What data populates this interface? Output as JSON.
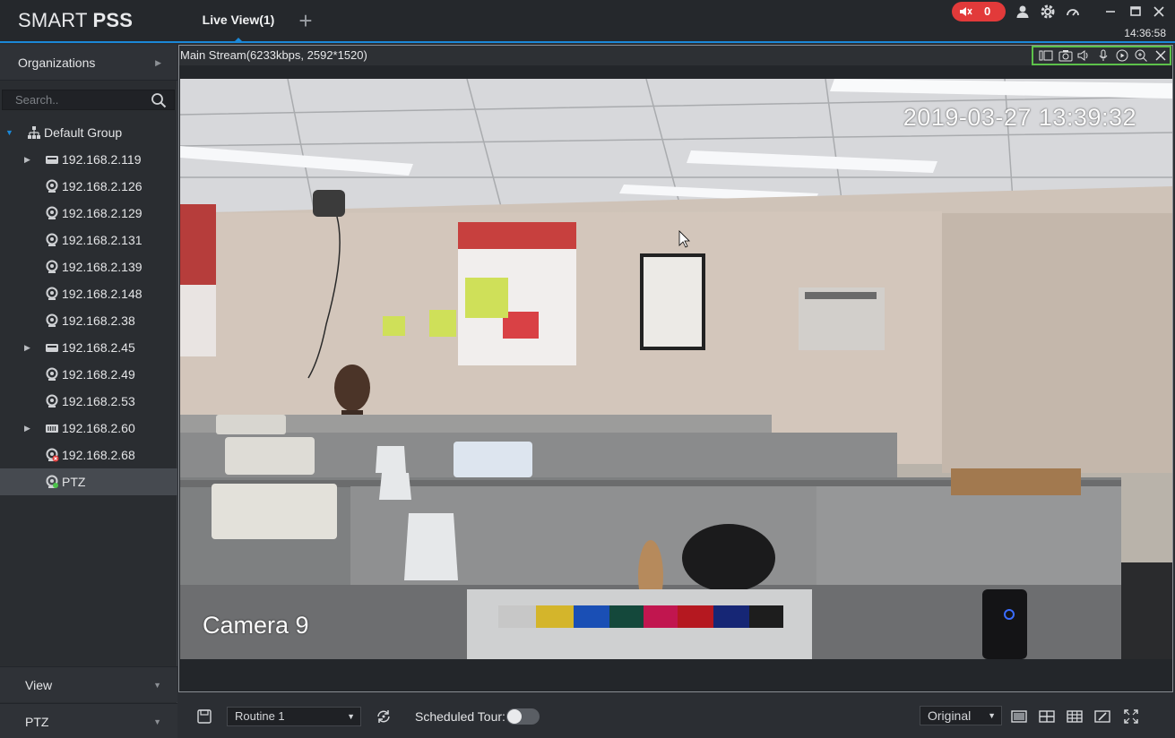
{
  "app": {
    "logo_thin": "SMART ",
    "logo_bold": "PSS",
    "tab_label": "Live View(1)",
    "add_tab": "+",
    "alarm_count": "0",
    "clock": "14:36:58",
    "accent_color": "#1b88d8",
    "alarm_color": "#e23a3a"
  },
  "sidebar": {
    "organizations_label": "Organizations",
    "search_placeholder": "Search..",
    "group_label": "Default Group",
    "devices": [
      {
        "label": "192.168.2.119",
        "type": "nvr",
        "expandable": true
      },
      {
        "label": "192.168.2.126",
        "type": "camera",
        "expandable": false
      },
      {
        "label": "192.168.2.129",
        "type": "camera",
        "expandable": false
      },
      {
        "label": "192.168.2.131",
        "type": "camera",
        "expandable": false
      },
      {
        "label": "192.168.2.139",
        "type": "camera",
        "expandable": false
      },
      {
        "label": "192.168.2.148",
        "type": "camera",
        "expandable": false
      },
      {
        "label": "192.168.2.38",
        "type": "camera",
        "expandable": false
      },
      {
        "label": "192.168.2.45",
        "type": "nvr",
        "expandable": true
      },
      {
        "label": "192.168.2.49",
        "type": "camera",
        "expandable": false
      },
      {
        "label": "192.168.2.53",
        "type": "camera",
        "expandable": false
      },
      {
        "label": "192.168.2.60",
        "type": "nvr-rack",
        "expandable": true
      },
      {
        "label": "192.168.2.68",
        "type": "camera-offline",
        "expandable": false
      },
      {
        "label": "PTZ",
        "type": "camera-live",
        "expandable": false,
        "selected": true
      }
    ],
    "view_label": "View",
    "ptz_label": "PTZ"
  },
  "video": {
    "stream_info": "Main Stream(6233kbps, 2592*1520)",
    "osd_timestamp": "2019-03-27 13:39:32",
    "osd_camera": "Camera 9",
    "toolbar_highlight_color": "#5dc14a"
  },
  "bottombar": {
    "routine_value": "Routine 1",
    "scheduled_tour_label": "Scheduled Tour:",
    "scheduled_tour_on": false,
    "ratio_value": "Original"
  }
}
